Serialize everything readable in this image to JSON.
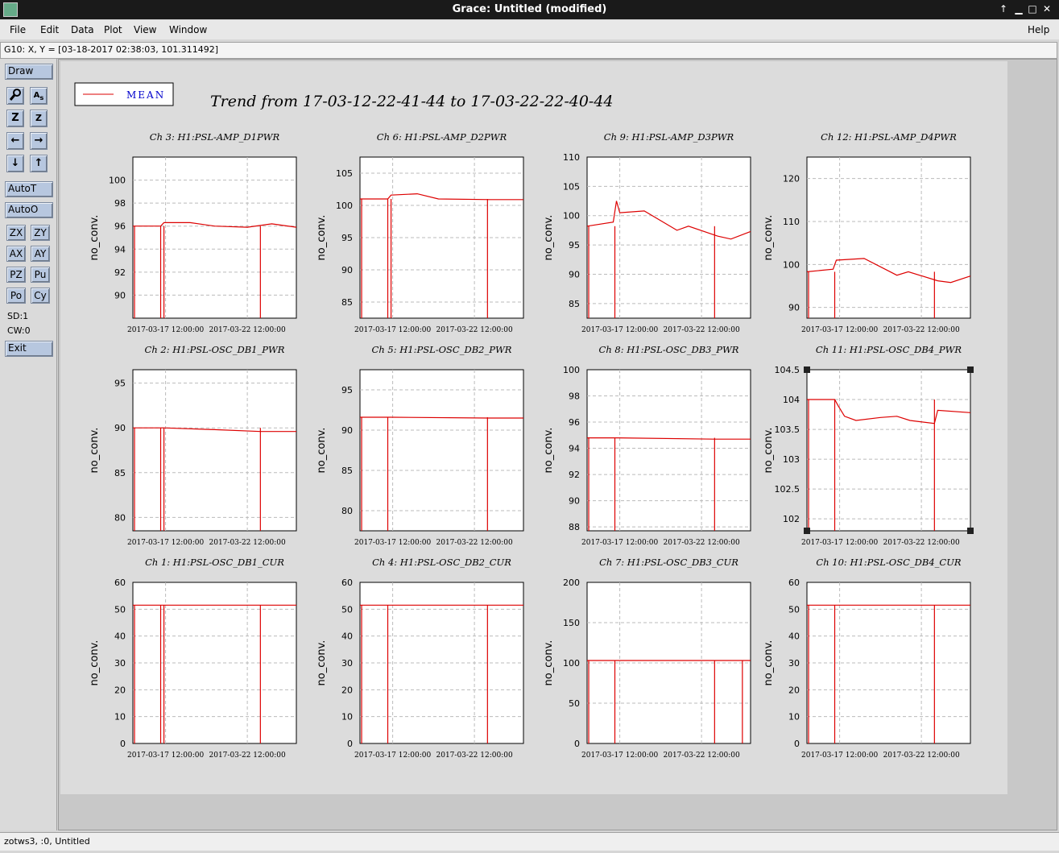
{
  "window": {
    "title": "Grace: Untitled (modified)",
    "buttons": [
      "↑",
      "▁",
      "□",
      "✕"
    ]
  },
  "menubar": {
    "items": [
      "File",
      "Edit",
      "Data",
      "Plot",
      "View",
      "Window"
    ],
    "help": "Help"
  },
  "locator": {
    "text": "G10: X, Y = [03-18-2017 02:38:03, 101.311492]"
  },
  "toolbox": {
    "draw": "Draw",
    "icons": [
      "magnify-icon",
      "text-icon",
      "zoom-z-icon",
      "zoom-z-small-icon",
      "arrow-left-icon",
      "arrow-right-icon",
      "arrow-down-icon",
      "arrow-up-icon"
    ],
    "autot": "AutoT",
    "autoo": "AutoO",
    "small": [
      "ZX",
      "ZY",
      "AX",
      "AY",
      "PZ",
      "Pu",
      "Po",
      "Cy"
    ],
    "sd": "SD:1",
    "cw": "CW:0",
    "exit": "Exit"
  },
  "status": {
    "text": "zotws3, :0, Untitled"
  },
  "chart_data": {
    "type": "line",
    "title": "Trend from 17-03-12-22-41-44 to 17-03-22-22-40-44",
    "legend": {
      "label": "MEAN",
      "placement": "top-left",
      "color": "#dd0000"
    },
    "series_color": "#dd0000",
    "x_ticks": [
      "2017-03-17 12:00:00",
      "2017-03-22 12:00:00"
    ],
    "ylabel": "no_conv.",
    "panels": [
      {
        "title": "Ch 3: H1:PSL-AMP_D1PWR",
        "ylim": [
          88,
          102
        ],
        "yticks": [
          90,
          92,
          94,
          96,
          98,
          100
        ],
        "series": [
          {
            "t": 0.0,
            "v": 96.0
          },
          {
            "t": 0.17,
            "v": 96.0
          },
          {
            "t": 0.19,
            "v": 96.3
          },
          {
            "t": 0.35,
            "v": 96.3
          },
          {
            "t": 0.5,
            "v": 96.0
          },
          {
            "t": 0.7,
            "v": 95.9
          },
          {
            "t": 0.85,
            "v": 96.2
          },
          {
            "t": 1.0,
            "v": 95.9
          }
        ],
        "drops": [
          0.01,
          0.17,
          0.19,
          0.78
        ]
      },
      {
        "title": "Ch 6: H1:PSL-AMP_D2PWR",
        "ylim": [
          82.5,
          107.5
        ],
        "yticks": [
          85,
          90,
          95,
          100,
          105
        ],
        "series": [
          {
            "t": 0.0,
            "v": 101.0
          },
          {
            "t": 0.17,
            "v": 101.0
          },
          {
            "t": 0.19,
            "v": 101.6
          },
          {
            "t": 0.35,
            "v": 101.8
          },
          {
            "t": 0.48,
            "v": 101.0
          },
          {
            "t": 0.8,
            "v": 100.9
          },
          {
            "t": 1.0,
            "v": 100.9
          }
        ],
        "drops": [
          0.01,
          0.17,
          0.19,
          0.78
        ]
      },
      {
        "title": "Ch 9: H1:PSL-AMP_D3PWR",
        "ylim": [
          82.5,
          110
        ],
        "yticks": [
          85,
          90,
          95,
          100,
          105,
          110
        ],
        "series": [
          {
            "t": 0.0,
            "v": 98.2
          },
          {
            "t": 0.16,
            "v": 98.9
          },
          {
            "t": 0.18,
            "v": 102.5
          },
          {
            "t": 0.2,
            "v": 100.5
          },
          {
            "t": 0.35,
            "v": 100.8
          },
          {
            "t": 0.55,
            "v": 97.5
          },
          {
            "t": 0.62,
            "v": 98.2
          },
          {
            "t": 0.8,
            "v": 96.5
          },
          {
            "t": 0.88,
            "v": 96.0
          },
          {
            "t": 1.0,
            "v": 97.3
          }
        ],
        "drops": [
          0.01,
          0.17,
          0.78
        ]
      },
      {
        "title": "Ch 12: H1:PSL-AMP_D4PWR",
        "ylim": [
          87.5,
          125
        ],
        "yticks": [
          90,
          100,
          110,
          120
        ],
        "series": [
          {
            "t": 0.0,
            "v": 98.3
          },
          {
            "t": 0.16,
            "v": 98.9
          },
          {
            "t": 0.18,
            "v": 101.0
          },
          {
            "t": 0.35,
            "v": 101.4
          },
          {
            "t": 0.55,
            "v": 97.5
          },
          {
            "t": 0.62,
            "v": 98.3
          },
          {
            "t": 0.8,
            "v": 96.2
          },
          {
            "t": 0.88,
            "v": 95.8
          },
          {
            "t": 1.0,
            "v": 97.3
          }
        ],
        "drops": [
          0.01,
          0.17,
          0.78
        ]
      },
      {
        "title": "Ch 2: H1:PSL-OSC_DB1_PWR",
        "ylim": [
          78.5,
          96.5
        ],
        "yticks": [
          80,
          85,
          90,
          95
        ],
        "series": [
          {
            "t": 0.0,
            "v": 90.0
          },
          {
            "t": 0.17,
            "v": 90.0
          },
          {
            "t": 0.19,
            "v": 90.0
          },
          {
            "t": 0.5,
            "v": 89.8
          },
          {
            "t": 0.78,
            "v": 89.6
          },
          {
            "t": 1.0,
            "v": 89.6
          }
        ],
        "drops": [
          0.01,
          0.17,
          0.19,
          0.78
        ]
      },
      {
        "title": "Ch 5: H1:PSL-OSC_DB2_PWR",
        "ylim": [
          77.5,
          97.5
        ],
        "yticks": [
          80,
          85,
          90,
          95
        ],
        "series": [
          {
            "t": 0.0,
            "v": 91.6
          },
          {
            "t": 0.17,
            "v": 91.6
          },
          {
            "t": 0.19,
            "v": 91.6
          },
          {
            "t": 0.78,
            "v": 91.5
          },
          {
            "t": 1.0,
            "v": 91.5
          }
        ],
        "drops": [
          0.01,
          0.17,
          0.78
        ]
      },
      {
        "title": "Ch 8: H1:PSL-OSC_DB3_PWR",
        "ylim": [
          87.7,
          100
        ],
        "yticks": [
          88,
          90,
          92,
          94,
          96,
          98,
          100
        ],
        "series": [
          {
            "t": 0.0,
            "v": 94.8
          },
          {
            "t": 0.17,
            "v": 94.8
          },
          {
            "t": 0.19,
            "v": 94.8
          },
          {
            "t": 0.78,
            "v": 94.7
          },
          {
            "t": 1.0,
            "v": 94.7
          }
        ],
        "drops": [
          0.01,
          0.17,
          0.78
        ]
      },
      {
        "title": "Ch 11: H1:PSL-OSC_DB4_PWR",
        "ylim": [
          101.8,
          104.5
        ],
        "yticks": [
          102,
          102.5,
          103,
          103.5,
          104,
          104.5
        ],
        "series": [
          {
            "t": 0.0,
            "v": 104.0
          },
          {
            "t": 0.17,
            "v": 104.0
          },
          {
            "t": 0.19,
            "v": 103.9
          },
          {
            "t": 0.23,
            "v": 103.72
          },
          {
            "t": 0.3,
            "v": 103.65
          },
          {
            "t": 0.45,
            "v": 103.7
          },
          {
            "t": 0.55,
            "v": 103.72
          },
          {
            "t": 0.63,
            "v": 103.65
          },
          {
            "t": 0.78,
            "v": 103.6
          },
          {
            "t": 0.8,
            "v": 103.82
          },
          {
            "t": 1.0,
            "v": 103.78
          }
        ],
        "drops": [
          0.01,
          0.17,
          0.78
        ],
        "selected": true
      },
      {
        "title": "Ch 1: H1:PSL-OSC_DB1_CUR",
        "ylim": [
          0,
          60
        ],
        "yticks": [
          0,
          10,
          20,
          30,
          40,
          50,
          60
        ],
        "series": [
          {
            "t": 0.0,
            "v": 51.5
          },
          {
            "t": 1.0,
            "v": 51.5
          }
        ],
        "drops": [
          0.01,
          0.17,
          0.19,
          0.78
        ]
      },
      {
        "title": "Ch 4: H1:PSL-OSC_DB2_CUR",
        "ylim": [
          0,
          60
        ],
        "yticks": [
          0,
          10,
          20,
          30,
          40,
          50,
          60
        ],
        "series": [
          {
            "t": 0.0,
            "v": 51.5
          },
          {
            "t": 1.0,
            "v": 51.5
          }
        ],
        "drops": [
          0.01,
          0.17,
          0.78
        ]
      },
      {
        "title": "Ch 7: H1:PSL-OSC_DB3_CUR",
        "ylim": [
          0,
          200
        ],
        "yticks": [
          0,
          50,
          100,
          150,
          200
        ],
        "series": [
          {
            "t": 0.0,
            "v": 103.0
          },
          {
            "t": 1.0,
            "v": 103.0
          }
        ],
        "drops": [
          0.01,
          0.17,
          0.78,
          0.95
        ]
      },
      {
        "title": "Ch 10: H1:PSL-OSC_DB4_CUR",
        "ylim": [
          0,
          60
        ],
        "yticks": [
          0,
          10,
          20,
          30,
          40,
          50,
          60
        ],
        "series": [
          {
            "t": 0.0,
            "v": 51.5
          },
          {
            "t": 1.0,
            "v": 51.5
          }
        ],
        "drops": [
          0.01,
          0.17,
          0.78
        ]
      }
    ]
  }
}
